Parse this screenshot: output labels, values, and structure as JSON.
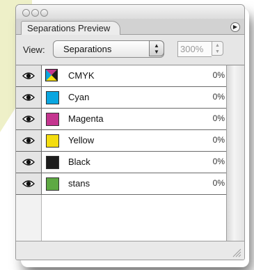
{
  "window": {
    "tab_title": "Separations Preview"
  },
  "toolbar": {
    "view_label": "View:",
    "view_value": "Separations",
    "zoom_value": "300%"
  },
  "separations": [
    {
      "label": "CMYK",
      "percent": "0%",
      "swatch": "cmyk"
    },
    {
      "label": "Cyan",
      "percent": "0%",
      "swatch": "#0aa6e0"
    },
    {
      "label": "Magenta",
      "percent": "0%",
      "swatch": "#c4358f"
    },
    {
      "label": "Yellow",
      "percent": "0%",
      "swatch": "#f4dd10"
    },
    {
      "label": "Black",
      "percent": "0%",
      "swatch": "#1c1c1c"
    },
    {
      "label": "stans",
      "percent": "0%",
      "swatch": "#5ea943"
    }
  ],
  "icons": {
    "visibility": "eye-icon",
    "panel_menu": "flyout-menu-icon",
    "resize": "resize-grip-icon"
  },
  "colors": {
    "accent_background": "#eef0c8"
  }
}
